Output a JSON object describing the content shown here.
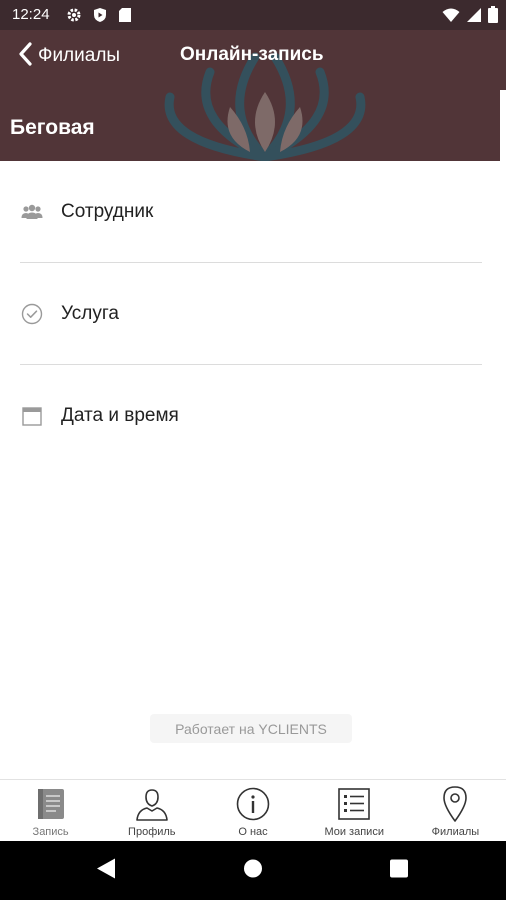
{
  "status_bar": {
    "time": "12:24",
    "left_icons": [
      "gear-icon",
      "shield-icon",
      "sd-card-icon"
    ],
    "right_icons": [
      "wifi-icon",
      "signal-icon",
      "battery-icon"
    ]
  },
  "header": {
    "back_label": "Филиалы",
    "title": "Онлайн-запись",
    "branch_name": "Беговая",
    "background_color": "#513538"
  },
  "menu": {
    "items": [
      {
        "icon": "people-icon",
        "label": "Сотрудник"
      },
      {
        "icon": "check-circle-icon",
        "label": "Услуга"
      },
      {
        "icon": "calendar-icon",
        "label": "Дата и время"
      }
    ]
  },
  "powered_by": "Работает на YCLIENTS",
  "tabbar": {
    "tabs": [
      {
        "icon": "book-icon",
        "label": "Запись",
        "active": true
      },
      {
        "icon": "profile-icon",
        "label": "Профиль",
        "active": false
      },
      {
        "icon": "info-icon",
        "label": "О нас",
        "active": false
      },
      {
        "icon": "list-icon",
        "label": "Мои записи",
        "active": false
      },
      {
        "icon": "map-pin-icon",
        "label": "Филиалы",
        "active": false
      }
    ]
  },
  "nav_bar": {
    "buttons": [
      "back-triangle-icon",
      "home-circle-icon",
      "recents-square-icon"
    ]
  }
}
